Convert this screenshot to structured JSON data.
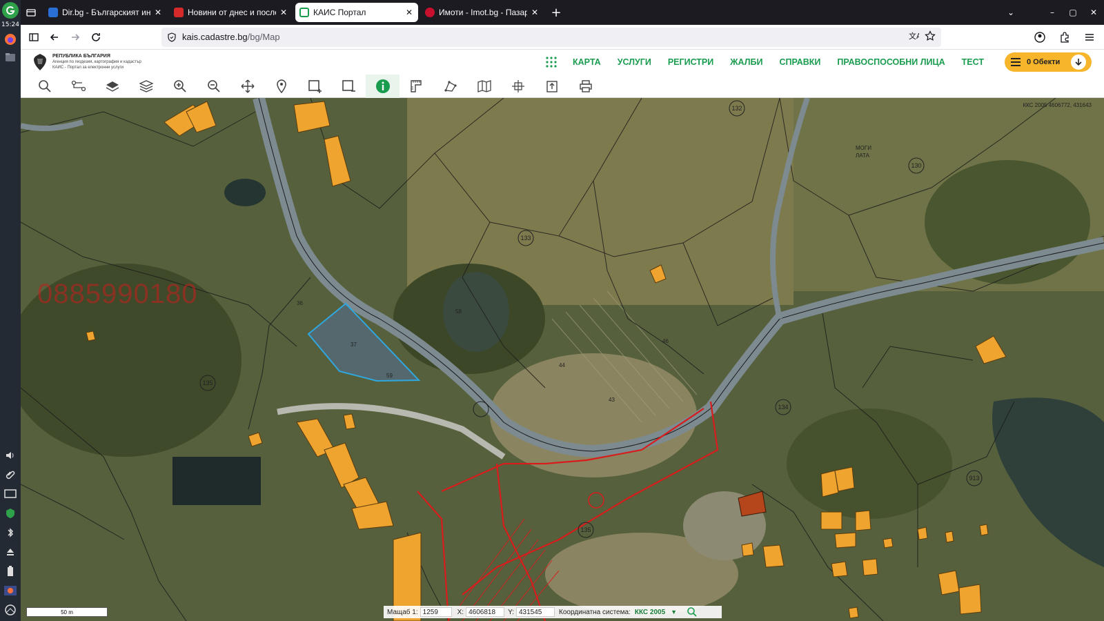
{
  "os_panel": {
    "time": "15:24"
  },
  "tabs": [
    {
      "title": "Dir.bg - Българският инт",
      "favicon_color": "#2a6fd6"
    },
    {
      "title": "Новини от днес и после",
      "favicon_color": "#d62a2a"
    },
    {
      "title": "КАИС Портал",
      "favicon_color": "#1a9c4f"
    },
    {
      "title": "Имоти - Imot.bg - Пазар",
      "favicon_color": "#c8102e"
    }
  ],
  "active_tab_index": 2,
  "address": {
    "protocol_hidden": true,
    "host": "kais.cadastre.bg",
    "path": "/bg/Map"
  },
  "site": {
    "logo": {
      "line1": "РЕПУБЛИКА БЪЛГАРИЯ",
      "line2": "Агенция по геодезия, картография и кадастър",
      "line3": "КАИС - Портал за електронни услуги"
    },
    "menu": [
      "КАРТА",
      "УСЛУГИ",
      "РЕГИСТРИ",
      "ЖАЛБИ",
      "СПРАВКИ",
      "ПРАВОСПОСОБНИ ЛИЦА",
      "ТЕСТ"
    ],
    "objects_label": "0 Обекти",
    "accent_color": "#1a9c4f",
    "objects_color": "#f7b52c"
  },
  "toolbar": {
    "tools": [
      "search-tool",
      "route-tool",
      "layer-tool",
      "layers-tool",
      "zoom-in-tool",
      "zoom-out-tool",
      "pan-tool",
      "location-tool",
      "select-area-tool",
      "select-rect-tool",
      "info-tool",
      "measure-tool",
      "draw-tool",
      "map-tool",
      "coords-tool",
      "export-tool",
      "print-tool"
    ],
    "active_tool": "info-tool"
  },
  "map": {
    "coord_readout": "ККС 2005 4606772, 431643",
    "watermark": "0885990180",
    "scale_label": "50 m",
    "parcel_labels": [
      "132",
      "130",
      "135",
      "136",
      "134",
      "133",
      "913",
      "58",
      "59"
    ],
    "status": {
      "scale_label": "Мащаб 1:",
      "scale_value": "1259",
      "x_label": "X:",
      "x_value": "4606818",
      "y_label": "Y:",
      "y_value": "431545",
      "crs_label": "Координатна система:",
      "crs_value": "ККС 2005"
    }
  }
}
